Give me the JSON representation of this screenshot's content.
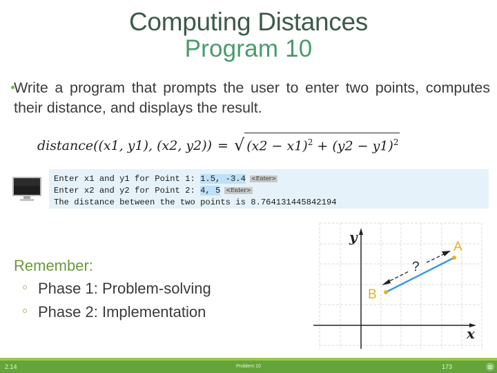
{
  "slide": {
    "title_line1": "Computing Distances",
    "title_line2": "Program 10",
    "intro_text": "Write a program that prompts the user to enter two points, computes their distance, and displays the result.",
    "formula": {
      "lhs": "distance((x1, y1), (x2, y2))",
      "equals": "=",
      "term1": "(x2  − x1)",
      "plus": " + ",
      "term2": "(y2  − y1)",
      "exponent": "2"
    },
    "console": {
      "icon": "monitor-icon",
      "lines": [
        {
          "prompt": "Enter x1 and y1 for Point 1: ",
          "input": "1.5, -3.4",
          "key": "<Enter>"
        },
        {
          "prompt": "Enter x2 and y2 for Point 2: ",
          "input": "4, 5",
          "key": "<Enter>"
        },
        {
          "prompt": "The distance between the two points is 8.764131445842194",
          "input": "",
          "key": ""
        }
      ]
    },
    "remember_label": "Remember:",
    "phases": [
      "Phase 1: Problem-solving",
      "Phase 2: Implementation"
    ],
    "diagram": {
      "x_axis_label": "x",
      "y_axis_label": "y",
      "point_a_label": "A",
      "point_b_label": "B",
      "question_label": "?",
      "point_color": "#e8b21c",
      "segment_color": "#3a9ad9"
    }
  },
  "footer": {
    "left_text": "2.14",
    "center_text": "Problem 10",
    "right_text": "173",
    "menu_icon": "menu-icon"
  }
}
